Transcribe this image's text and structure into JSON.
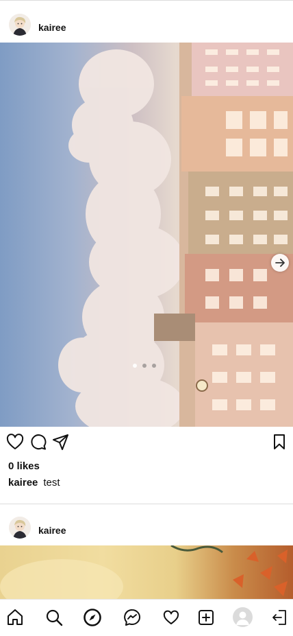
{
  "posts": [
    {
      "username": "kairee",
      "likes_text": "0 likes",
      "caption_user": "kairee",
      "caption_text": "test",
      "carousel": {
        "count": 3,
        "active_index": 0
      }
    },
    {
      "username": "kairee"
    }
  ],
  "bottom_nav": {
    "items": [
      "home-icon",
      "search-icon",
      "explore-icon",
      "messenger-icon",
      "heart-icon",
      "new-post-icon",
      "profile-avatar",
      "logout-icon"
    ],
    "active": "explore-icon"
  }
}
